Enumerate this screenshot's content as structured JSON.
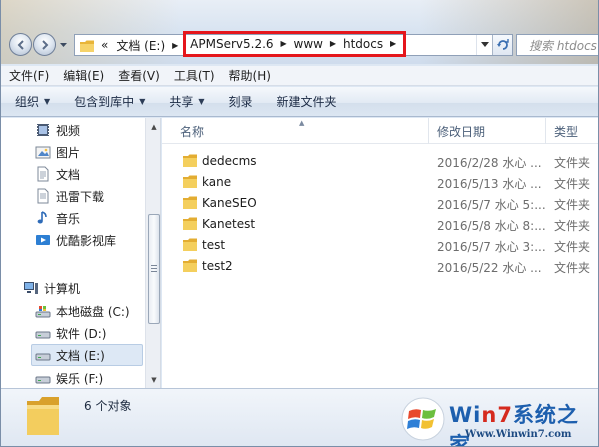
{
  "address_bar": {
    "overflow_glyph": "«",
    "root": "文档 (E:)",
    "path": [
      "APMServ5.2.6",
      "www",
      "htdocs"
    ]
  },
  "search": {
    "placeholder": "搜索 htdocs"
  },
  "menu": [
    "文件(F)",
    "编辑(E)",
    "查看(V)",
    "工具(T)",
    "帮助(H)"
  ],
  "toolbar": {
    "organize": "组织",
    "include_library": "包含到库中",
    "share": "共享",
    "burn": "刻录",
    "new_folder": "新建文件夹"
  },
  "nav_pane": {
    "libraries": [
      {
        "label": "视频",
        "icon": "video-icon"
      },
      {
        "label": "图片",
        "icon": "picture-icon"
      },
      {
        "label": "文档",
        "icon": "document-icon"
      },
      {
        "label": "迅雷下载",
        "icon": "download-icon"
      },
      {
        "label": "音乐",
        "icon": "music-icon"
      },
      {
        "label": "优酷影视库",
        "icon": "media-library-icon"
      }
    ],
    "computer": {
      "label": "计算机",
      "icon": "computer-icon"
    },
    "drives": [
      {
        "label": "本地磁盘 (C:)",
        "icon": "system-drive-icon"
      },
      {
        "label": "软件 (D:)",
        "icon": "drive-icon"
      },
      {
        "label": "文档 (E:)",
        "icon": "drive-icon",
        "selected": true
      },
      {
        "label": "娱乐 (F:)",
        "icon": "drive-icon"
      }
    ]
  },
  "columns": {
    "name": "名称",
    "date": "修改日期",
    "type": "类型"
  },
  "files": [
    {
      "name": "dedecms",
      "date": "2016/2/28 水心 ...",
      "type": "文件夹"
    },
    {
      "name": "kane",
      "date": "2016/5/13 水心 ...",
      "type": "文件夹"
    },
    {
      "name": "KaneSEO",
      "date": "2016/5/7 水心 5:...",
      "type": "文件夹"
    },
    {
      "name": "Kanetest",
      "date": "2016/5/8 水心 8:...",
      "type": "文件夹"
    },
    {
      "name": "test",
      "date": "2016/5/7 水心 3:...",
      "type": "文件夹"
    },
    {
      "name": "test2",
      "date": "2016/5/22 水心 ...",
      "type": "文件夹"
    }
  ],
  "status": {
    "count": "6 个对象"
  },
  "watermark": {
    "brand_prefix": "Wi",
    "brand_seven": "n7",
    "brand_suffix": "系统之家",
    "url": "Www.Winwin7.com"
  },
  "colors": {
    "highlight_box": "#e5161c",
    "folder": "#f2c54d",
    "brand_blue": "#1d5fae",
    "brand_red": "#d52a1e"
  }
}
